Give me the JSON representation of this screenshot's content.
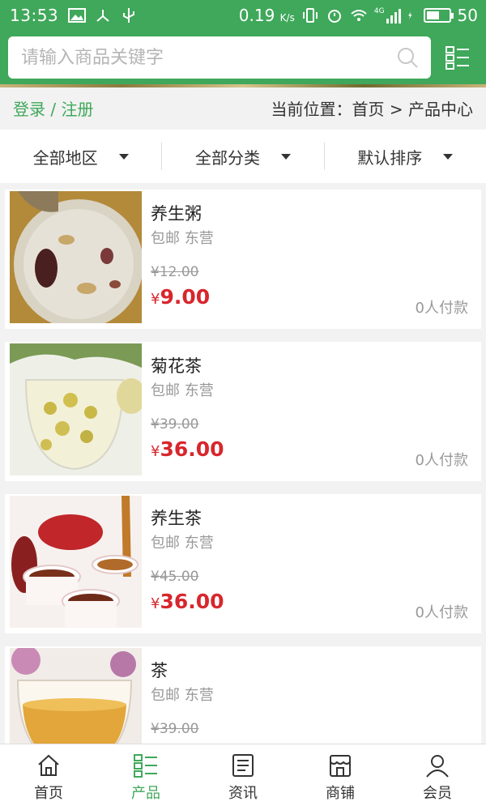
{
  "status_bar": {
    "time": "13:53",
    "speed": "0.19",
    "speed_unit": "K/s",
    "network": "4G",
    "battery_level": "50"
  },
  "search": {
    "placeholder": "请输入商品关键字"
  },
  "breadcrumb_bar": {
    "login": "登录",
    "separator": " / ",
    "register": "注册",
    "location": "当前位置：首页 > 产品中心"
  },
  "filters": [
    {
      "label": "全部地区"
    },
    {
      "label": "全部分类"
    },
    {
      "label": "默认排序"
    }
  ],
  "products": [
    {
      "name": "养生粥",
      "location": "包邮 东营",
      "old_price": "¥12.00",
      "price_symbol": "¥",
      "price": "9.00",
      "paid": "0人付款"
    },
    {
      "name": "菊花茶",
      "location": "包邮 东营",
      "old_price": "¥39.00",
      "price_symbol": "¥",
      "price": "36.00",
      "paid": "0人付款"
    },
    {
      "name": "养生茶",
      "location": "包邮 东营",
      "old_price": "¥45.00",
      "price_symbol": "¥",
      "price": "36.00",
      "paid": "0人付款"
    },
    {
      "name": "茶",
      "location": "包邮 东营",
      "old_price": "¥39.00",
      "price_symbol": "¥",
      "price": "",
      "paid": ""
    }
  ],
  "bottom_nav": [
    {
      "label": "首页",
      "icon": "home-icon"
    },
    {
      "label": "产品",
      "icon": "grid-list-icon",
      "active": true
    },
    {
      "label": "资讯",
      "icon": "news-icon"
    },
    {
      "label": "商铺",
      "icon": "shop-icon"
    },
    {
      "label": "会员",
      "icon": "user-icon"
    }
  ],
  "colors": {
    "brand_green": "#3fa85a",
    "price_red": "#d8262d",
    "muted_gray": "#999999"
  }
}
